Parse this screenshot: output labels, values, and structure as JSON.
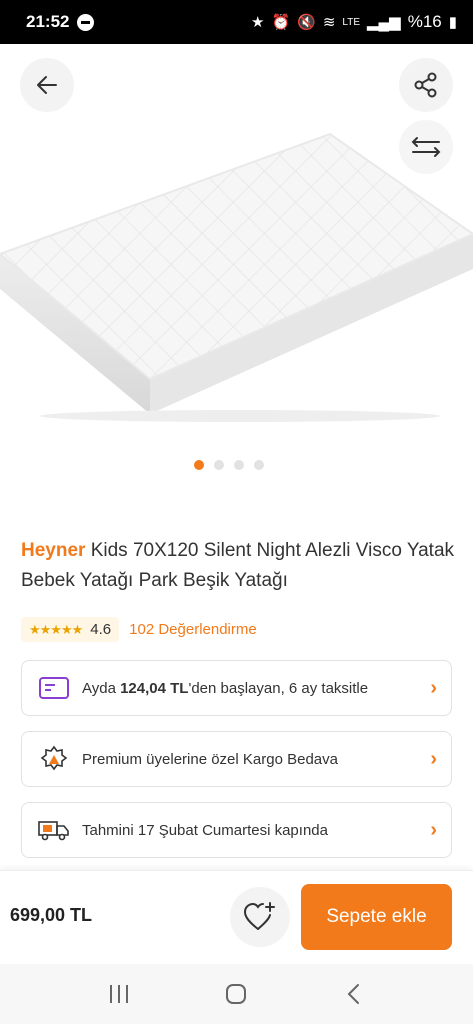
{
  "status": {
    "time": "21:52",
    "network": "LTE",
    "battery": "%16"
  },
  "product": {
    "brand": "Heyner",
    "title_rest": " Kids 70X120 Silent Night Alezli Visco Yatak Bebek Yatağı Park Beşik Yatağı",
    "rating_value": "4.6",
    "rating_stars": 4.6,
    "reviews_label": "102 Değerlendirme",
    "image_count": 4,
    "active_image": 1
  },
  "cards": {
    "installment_pre": "Ayda ",
    "installment_amount": "124,04 TL",
    "installment_post": "'den başlayan, 6 ay taksitle",
    "shipping": "Premium üyelerine özel Kargo Bedava",
    "delivery": "Tahmini 17 Şubat Cumartesi kapında"
  },
  "bottom": {
    "price": "699,00 TL",
    "cart_label": "Sepete ekle"
  },
  "colors": {
    "accent": "#f27a1a",
    "star": "#e8a500",
    "installment_icon": "#8a3fd1"
  },
  "icons": {
    "back": "arrow-left-icon",
    "share": "share-icon",
    "compare": "compare-arrows-icon",
    "favorite": "heart-plus-icon"
  }
}
